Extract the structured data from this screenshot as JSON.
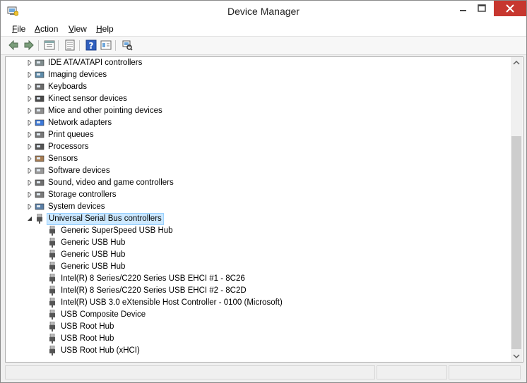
{
  "window": {
    "title": "Device Manager"
  },
  "menu": [
    "File",
    "Action",
    "View",
    "Help"
  ],
  "toolbar": {
    "buttons": [
      "back-arrow-icon",
      "forward-arrow-icon",
      "properties-grid-icon",
      "list-view-icon",
      "help-icon",
      "details-view-icon",
      "scan-hardware-icon"
    ]
  },
  "tree": {
    "categories": [
      {
        "label": "IDE ATA/ATAPI controllers",
        "icon": "ide-controller-icon"
      },
      {
        "label": "Imaging devices",
        "icon": "camera-icon"
      },
      {
        "label": "Keyboards",
        "icon": "keyboard-icon"
      },
      {
        "label": "Kinect sensor devices",
        "icon": "kinect-sensor-icon"
      },
      {
        "label": "Mice and other pointing devices",
        "icon": "mouse-icon"
      },
      {
        "label": "Network adapters",
        "icon": "network-adapter-icon"
      },
      {
        "label": "Print queues",
        "icon": "printer-icon"
      },
      {
        "label": "Processors",
        "icon": "processor-icon"
      },
      {
        "label": "Sensors",
        "icon": "sensor-icon"
      },
      {
        "label": "Software devices",
        "icon": "software-device-icon"
      },
      {
        "label": "Sound, video and game controllers",
        "icon": "speaker-icon"
      },
      {
        "label": "Storage controllers",
        "icon": "storage-controller-icon"
      },
      {
        "label": "System devices",
        "icon": "system-device-icon"
      }
    ],
    "expanded": {
      "label": "Universal Serial Bus controllers",
      "icon": "usb-controller-icon",
      "children": [
        "Generic SuperSpeed USB Hub",
        "Generic USB Hub",
        "Generic USB Hub",
        "Generic USB Hub",
        "Intel(R) 8 Series/C220 Series USB EHCI #1 - 8C26",
        "Intel(R) 8 Series/C220 Series USB EHCI #2 - 8C2D",
        "Intel(R) USB 3.0 eXtensible Host Controller - 0100 (Microsoft)",
        "USB Composite Device",
        "USB Root Hub",
        "USB Root Hub",
        "USB Root Hub (xHCI)"
      ]
    }
  },
  "colors": {
    "selection_bg": "#cce8ff",
    "selection_border": "#99d1ff",
    "close_button": "#c7372f"
  }
}
